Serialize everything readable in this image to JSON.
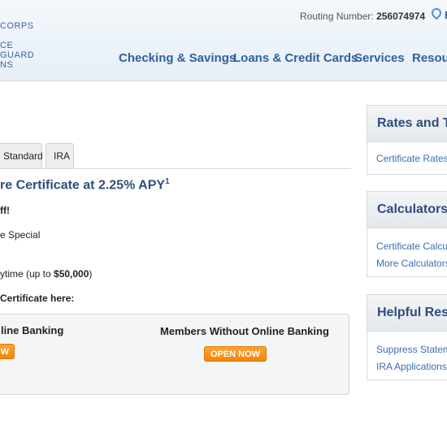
{
  "header": {
    "logo_line1": "CORPS",
    "logo_line2": "CE",
    "logo_line3": "GUARD",
    "logo_line4": "NS",
    "routing_label": "Routing Number:",
    "routing_number": "256074974",
    "branch_label": "B"
  },
  "nav": {
    "items": [
      "Checking & Savings",
      "Loans & Credit Cards",
      "Services",
      "Resou"
    ]
  },
  "tabs": [
    "Standard",
    "IRA"
  ],
  "main": {
    "headline": "re Certificate at 2.25% APY",
    "headline_sup": "1",
    "line1": "ff!",
    "line2": "e Special",
    "line3_prefix": "ytime (up to ",
    "line3_amount": "$50,000",
    "line3_suffix": ")",
    "open_heading": " Certificate here:"
  },
  "panel": {
    "left_heading": "line Banking",
    "left_button": "W",
    "right_heading": "Members Without Online Banking",
    "right_button": "OPEN NOW"
  },
  "sidebar": {
    "rates": {
      "title": "Rates and Te",
      "links": [
        "Certificate Rates"
      ]
    },
    "calculators": {
      "title": "Calculators",
      "links": [
        "Certificate Calcula",
        "More Calculators"
      ]
    },
    "resources": {
      "title": "Helpful Reso",
      "links": [
        "Suppress Stateme",
        "IRA Applications"
      ]
    }
  }
}
